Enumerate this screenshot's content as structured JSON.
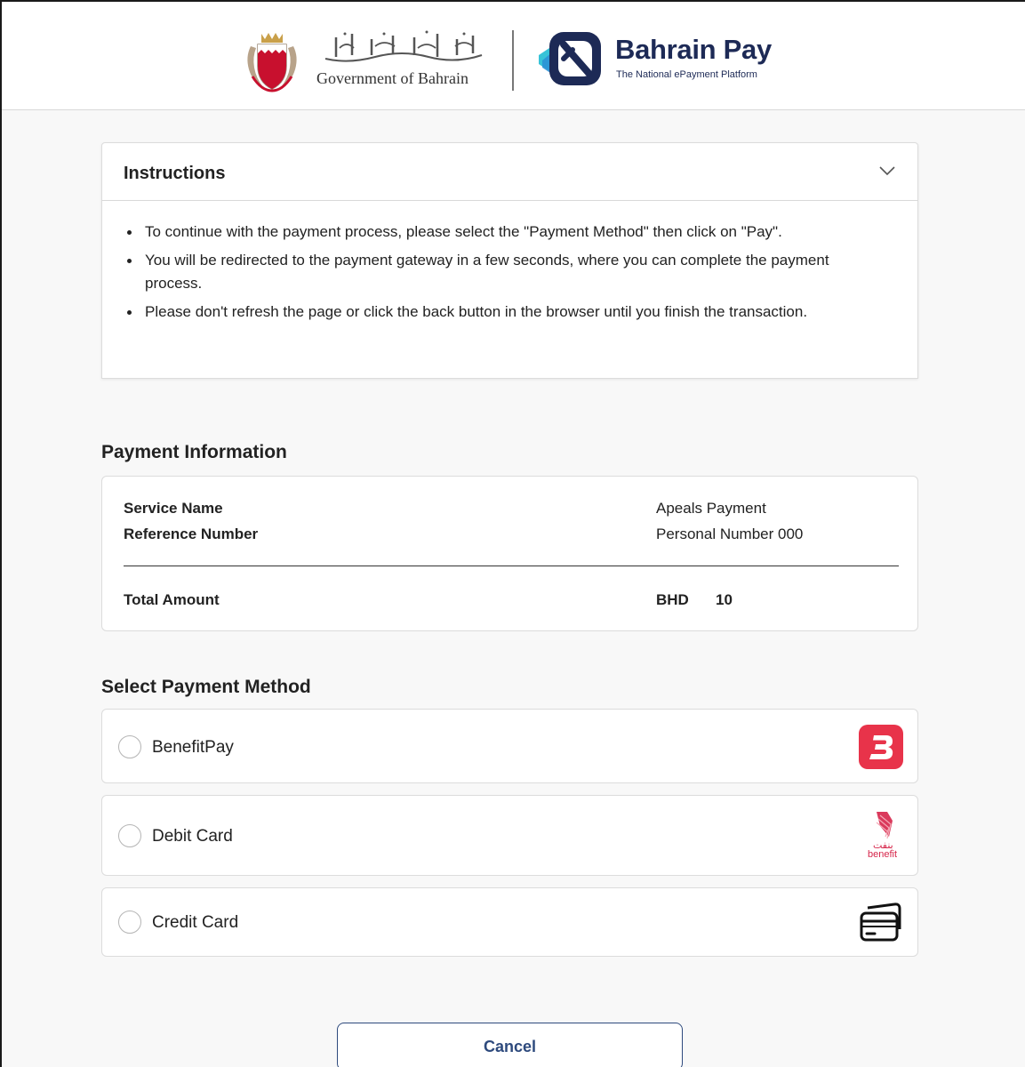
{
  "header": {
    "gov_name_en": "Government of Bahrain",
    "gov_name_ar": "حكومة مملكة البحرين",
    "emblem_icon": "bahrain-emblem-icon",
    "platform_name": "Bahrain Pay",
    "platform_tagline": "The National ePayment Platform",
    "brand_color": "#1d2a56"
  },
  "instructions": {
    "title": "Instructions",
    "toggle_icon": "chevron-down-icon",
    "items": [
      "To continue with the payment process, please select the \"Payment Method\" then click on \"Pay\".",
      "You will be redirected to the payment gateway in a few seconds, where you can complete the payment process.",
      "Please don't refresh the page or click the back button in the browser until you finish the transaction."
    ]
  },
  "payment_info": {
    "title": "Payment Information",
    "service_name_label": "Service Name",
    "service_name_value": "Apeals Payment",
    "reference_label": "Reference Number",
    "reference_value": "Personal Number 000",
    "total_label": "Total Amount",
    "currency": "BHD",
    "amount": "10"
  },
  "payment_methods": {
    "title": "Select Payment Method",
    "options": [
      {
        "label": "BenefitPay",
        "icon": "benefitpay-logo-icon",
        "color": "#e8334a"
      },
      {
        "label": "Debit Card",
        "icon": "benefit-logo-icon",
        "logo_text_ar": "بنفت",
        "logo_text_en": "benefit",
        "color": "#d6254a"
      },
      {
        "label": "Credit Card",
        "icon": "credit-card-icon"
      }
    ]
  },
  "actions": {
    "cancel_label": "Cancel",
    "accent": "#2e4a7d"
  }
}
